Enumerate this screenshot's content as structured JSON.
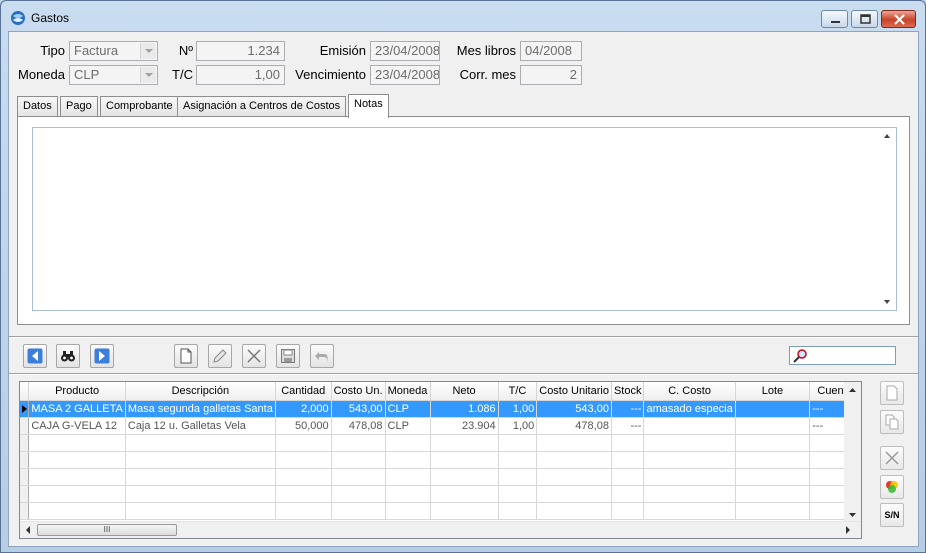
{
  "window": {
    "title": "Gastos",
    "icon": "app-logo-icon"
  },
  "header": {
    "tipo": {
      "label": "Tipo",
      "value": "Factura"
    },
    "numero": {
      "label": "Nº",
      "value": "1.234"
    },
    "emision": {
      "label": "Emisión",
      "value": "23/04/2008"
    },
    "mes_libros": {
      "label": "Mes libros",
      "value": "04/2008"
    },
    "moneda": {
      "label": "Moneda",
      "value": "CLP"
    },
    "tc": {
      "label": "T/C",
      "value": "1,00"
    },
    "vencimiento": {
      "label": "Vencimiento",
      "value": "23/04/2008"
    },
    "corr_mes": {
      "label": "Corr. mes",
      "value": "2"
    }
  },
  "tabs": [
    {
      "label": "Datos"
    },
    {
      "label": "Pago"
    },
    {
      "label": "Comprobante"
    },
    {
      "label": "Asignación a Centros de Costos"
    },
    {
      "label": "Notas",
      "active": true
    }
  ],
  "notes": {
    "value": ""
  },
  "toolbar": {
    "buttons": [
      "prev-icon",
      "find-binoculars-icon",
      "next-icon",
      "new-document-icon",
      "edit-pencil-icon",
      "delete-x-icon",
      "save-disk-icon",
      "undo-icon"
    ],
    "search_value": ""
  },
  "grid": {
    "columns": [
      "Producto",
      "Descripción",
      "Cantidad",
      "Costo Un.",
      "Moneda",
      "Neto",
      "T/C",
      "Costo Unitario",
      "Stock",
      "C. Costo",
      "Lote",
      "Cuenta"
    ],
    "rows": [
      [
        "MASA 2 GALLETA",
        "Masa segunda galletas Santa",
        "2,000",
        "543,00",
        "CLP",
        "1.086",
        "1,00",
        "543,00",
        "---",
        "amasado especia",
        "",
        "---"
      ],
      [
        "CAJA G-VELA 12",
        "Caja 12 u. Galletas Vela",
        "50,000",
        "478,08",
        "CLP",
        "23.904",
        "1,00",
        "478,08",
        "---",
        "",
        "",
        "---"
      ]
    ],
    "selected_row": 0,
    "empty_rows": 5,
    "scroll_thumb_label": "III"
  },
  "side_buttons": {
    "sn_label": "S/N",
    "icons": [
      "new-row-icon",
      "copy-row-icon",
      "delete-row-icon",
      "color-palette-icon"
    ]
  },
  "colors": {
    "selection": "#3399ff",
    "title_bar": "#c9dcf0",
    "close_button": "#c9432b"
  }
}
